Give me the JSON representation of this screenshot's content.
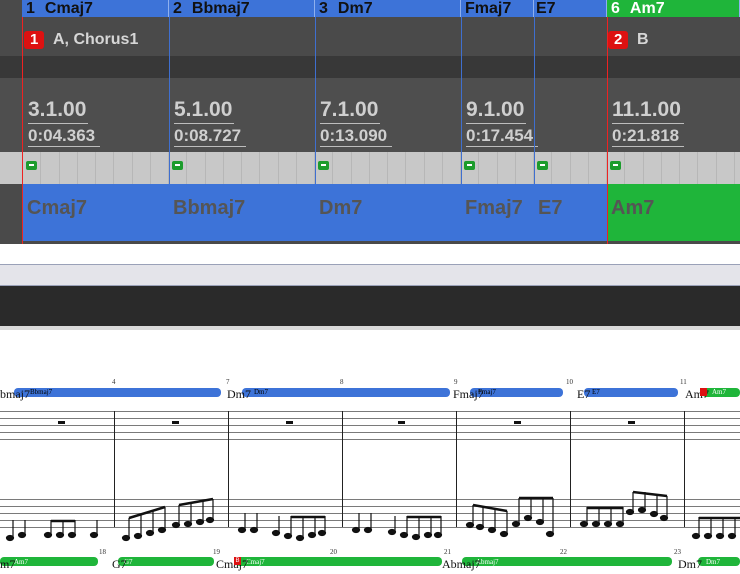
{
  "chord_track": [
    {
      "num": "1",
      "name": "Cmaj7"
    },
    {
      "num": "2",
      "name": "Bbmaj7"
    },
    {
      "num": "3",
      "name": "Dm7"
    },
    {
      "num": "",
      "name": "Fmaj7"
    },
    {
      "num": "",
      "name": "E7"
    },
    {
      "num": "6",
      "name": "Am7"
    }
  ],
  "sections": [
    {
      "badge": "1",
      "label": "A, Chorus1"
    },
    {
      "badge": "2",
      "label": "B"
    }
  ],
  "positions": [
    {
      "bbt": "3.1.00",
      "time": "0:04.363"
    },
    {
      "bbt": "5.1.00",
      "time": "0:08.727"
    },
    {
      "bbt": "7.1.00",
      "time": "0:13.090"
    },
    {
      "bbt": "9.1.00",
      "time": "0:17.454"
    },
    {
      "bbt": "11.1.00",
      "time": "0:21.818"
    }
  ],
  "chord_blocks": [
    "Cmaj7",
    "Bbmaj7",
    "Dm7",
    "Fmaj7",
    "E7",
    "Am7"
  ],
  "score": {
    "row1": {
      "measure_numbers": [
        "4",
        "7",
        "8",
        "9",
        "10",
        "11"
      ],
      "chord_names": [
        "bmaj7",
        "Dm7",
        "Fmaj7",
        "E7",
        "Am7"
      ],
      "bar_labels": [
        "Bbmaj7",
        "Dm7",
        "Fmaj7",
        "E7",
        "Am7"
      ]
    },
    "row2": {
      "measure_numbers": [
        "18",
        "19",
        "20",
        "21",
        "22",
        "23"
      ],
      "chord_names": [
        "m7",
        "G7",
        "Cmaj7",
        "Abmaj7",
        "Dm7"
      ],
      "bar_labels": [
        "Am7",
        "G7",
        "Cmaj7",
        "Abmaj7",
        "Dm7"
      ]
    },
    "red_marker": "B"
  },
  "colors": {
    "chord_blue": "#3d73d8",
    "chord_green": "#1fb53a",
    "section_red": "#dd1111",
    "panel_gray": "#4a4a4a"
  }
}
